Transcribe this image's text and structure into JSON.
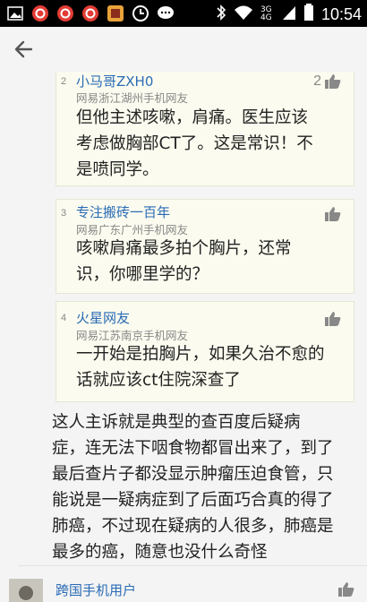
{
  "status_bar": {
    "time": "10:54",
    "network": "3G 4G",
    "left_icons": [
      "netease-news-icon",
      "netease-news-icon",
      "netease-news-icon",
      "app-icon",
      "data-saver-icon",
      "chat-icon"
    ],
    "right_icons": [
      "bluetooth-icon",
      "wifi-icon",
      "signal-icon",
      "battery-icon"
    ]
  },
  "app_bar": {
    "back_icon": "back-arrow-icon"
  },
  "quotes": [
    {
      "number": "2",
      "user": "小马哥ZXH0",
      "location": "网易浙江湖州手机网友",
      "lines": [
        "但他主述咳嗽，肩痛。医生应该",
        "考虑做胸部CT了。这是常识！不",
        "是喷同学。"
      ],
      "likes": "2"
    },
    {
      "number": "3",
      "user": "专注搬砖一百年",
      "location": "网易广东广州手机网友",
      "lines": [
        "咳嗽肩痛最多拍个胸片，还常",
        "识，你哪里学的？"
      ],
      "likes": ""
    },
    {
      "number": "4",
      "user": "火星网友",
      "location": "网易江苏南京手机网友",
      "lines": [
        "一开始是拍胸片，如果久治不愈的",
        "话就应该ct住院深查了"
      ],
      "likes": ""
    }
  ],
  "main_comment": {
    "lines": [
      "这人主诉就是典型的查百度后疑病",
      "症，连无法下咽食物都冒出来了，到了",
      "最后查片子都没显示肿瘤压迫食管，只",
      "能说是一疑病症到了后面巧合真的得了",
      "肺癌，不过现在疑病的人很多，肺癌是",
      "最多的癌，随意也没什么奇怪"
    ]
  },
  "next_comment": {
    "user": "跨国手机用户"
  },
  "colors": {
    "username": "#2a6bb5",
    "quote_bg": "#fbfbef",
    "page_bg": "#f4f4f4"
  }
}
